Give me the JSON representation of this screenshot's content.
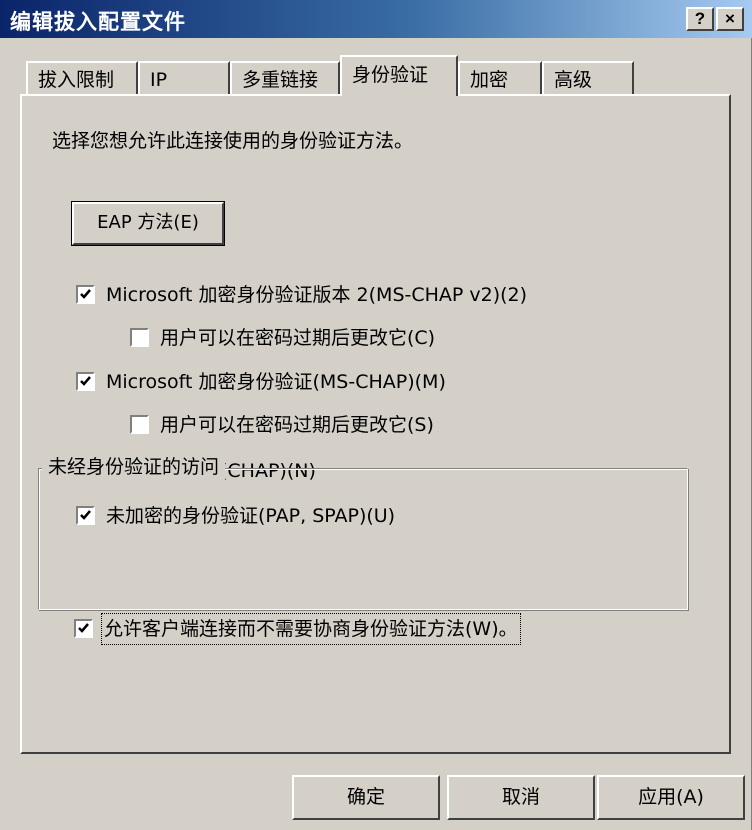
{
  "window": {
    "title": "编辑拔入配置文件",
    "help_button": "?",
    "close_button": "×"
  },
  "tabs": [
    {
      "label": "拔入限制",
      "active": false
    },
    {
      "label": "IP",
      "active": false
    },
    {
      "label": "多重链接",
      "active": false
    },
    {
      "label": "身份验证",
      "active": true
    },
    {
      "label": "加密",
      "active": false
    },
    {
      "label": "高级",
      "active": false
    }
  ],
  "auth": {
    "intro": "选择您想允许此连接使用的身份验证方法。",
    "eap_button": "EAP 方法(E)",
    "options": [
      {
        "label": "Microsoft 加密身份验证版本 2(MS-CHAP v2)(2)",
        "checked": true
      },
      {
        "label": "用户可以在密码过期后更改它(C)",
        "checked": false
      },
      {
        "label": "Microsoft 加密身份验证(MS-CHAP)(M)",
        "checked": true
      },
      {
        "label": "用户可以在密码过期后更改它(S)",
        "checked": false
      },
      {
        "label": "加密身份验证(CHAP)(N)",
        "checked": true
      },
      {
        "label": "未加密的身份验证(PAP, SPAP)(U)",
        "checked": true
      }
    ],
    "unauth_group": {
      "title": "未经身份验证的访问",
      "option": {
        "label": "允许客户端连接而不需要协商身份验证方法(W)。",
        "checked": true
      }
    }
  },
  "footer": {
    "ok": "确定",
    "cancel": "取消",
    "apply": "应用(A)"
  },
  "colors": {
    "dialog_face": "#d4d0c8",
    "titlebar_start": "#0a246a",
    "titlebar_end": "#a6caf0",
    "title_text": "#ffffff"
  }
}
